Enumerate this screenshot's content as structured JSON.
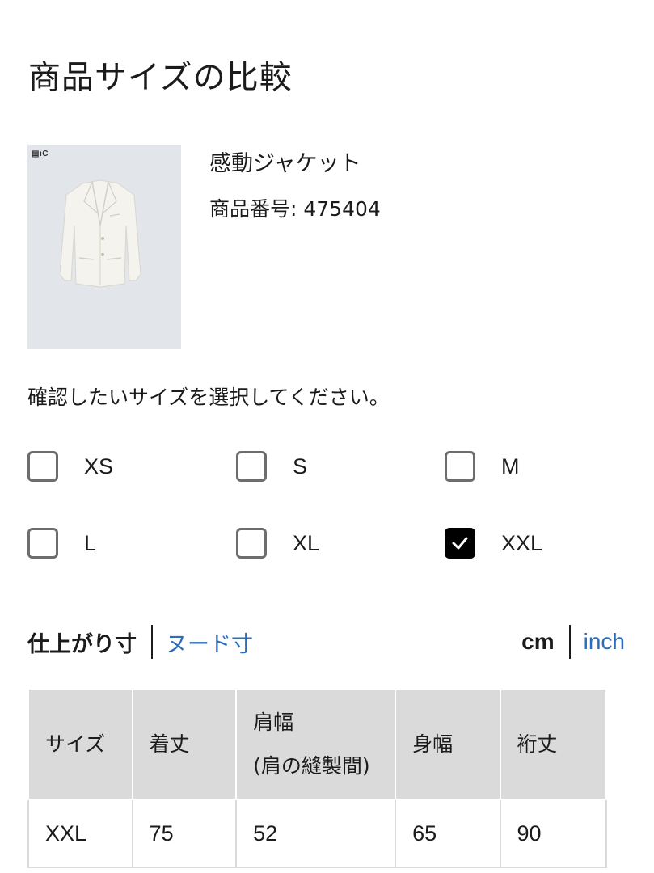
{
  "page_title": "商品サイズの比較",
  "product": {
    "name": "感動ジャケット",
    "number": "商品番号: 475404",
    "brand_mark": "▤ıC"
  },
  "size_selector": {
    "prompt": "確認したいサイズを選択してください。",
    "options": [
      {
        "label": "XS",
        "checked": false
      },
      {
        "label": "S",
        "checked": false
      },
      {
        "label": "M",
        "checked": false
      },
      {
        "label": "L",
        "checked": false
      },
      {
        "label": "XL",
        "checked": false
      },
      {
        "label": "XXL",
        "checked": true
      }
    ]
  },
  "measurement_tabs": {
    "active": "仕上がり寸",
    "inactive": "ヌード寸"
  },
  "unit_tabs": {
    "active": "cm",
    "inactive": "inch"
  },
  "size_table": {
    "headers": [
      "サイズ",
      "着丈",
      "肩幅",
      "(肩の縫製間)",
      "身幅",
      "裄丈"
    ],
    "rows": [
      [
        "XXL",
        "75",
        "52",
        "65",
        "90"
      ]
    ]
  },
  "colors": {
    "link": "#2a6ebb",
    "table_header_bg": "#dadada",
    "product_bg": "#e2e5e9",
    "checked_bg": "#000000"
  }
}
